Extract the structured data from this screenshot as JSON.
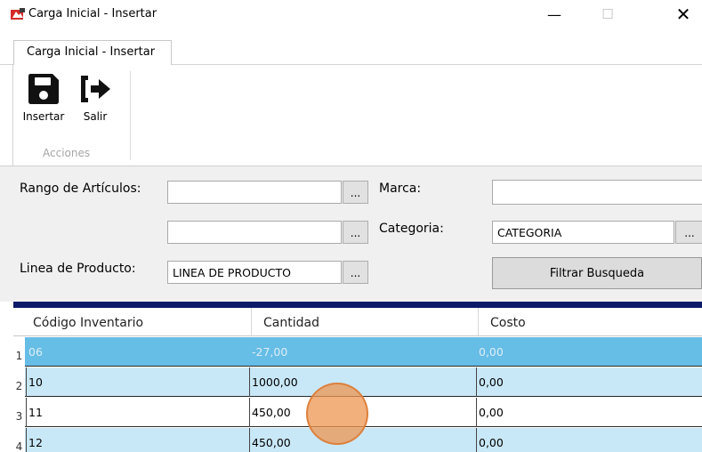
{
  "window": {
    "title": "Carga Inicial - Insertar",
    "minimize": "—",
    "maximize": "☐",
    "close": "✕"
  },
  "tabs": [
    {
      "label": "Carga Inicial - Insertar",
      "active": true
    }
  ],
  "ribbon": {
    "insertar_label": "Insertar",
    "salir_label": "Salir",
    "group_label": "Acciones",
    "icons": {
      "insertar": "save-icon",
      "salir": "exit-icon"
    }
  },
  "filters": {
    "rango_label": "Rango de Artículos:",
    "rango_desde": "",
    "rango_hasta": "",
    "marca_label": "Marca:",
    "marca_value": "",
    "categoria_label": "Categoria:",
    "categoria_value": "CATEGORIA",
    "linea_label": "Linea de Producto:",
    "linea_value": "LINEA DE PRODUCTO",
    "browse": "...",
    "filtrar_label": "Filtrar Busqueda"
  },
  "grid": {
    "columns": [
      "Código Inventario",
      "Cantidad",
      "Costo"
    ],
    "rows": [
      {
        "n": "1",
        "codigo": "06",
        "cantidad": "-27,00",
        "costo": "0,00"
      },
      {
        "n": "2",
        "codigo": "10",
        "cantidad": "1000,00",
        "costo": "0,00"
      },
      {
        "n": "3",
        "codigo": "11",
        "cantidad": "450,00",
        "costo": "0,00"
      },
      {
        "n": "4",
        "codigo": "12",
        "cantidad": "450,00",
        "costo": "0,00"
      }
    ]
  },
  "colors": {
    "header_band": "#0c1b68",
    "selected_row": "#66bde6",
    "alt_row": "#c9e8f7"
  }
}
